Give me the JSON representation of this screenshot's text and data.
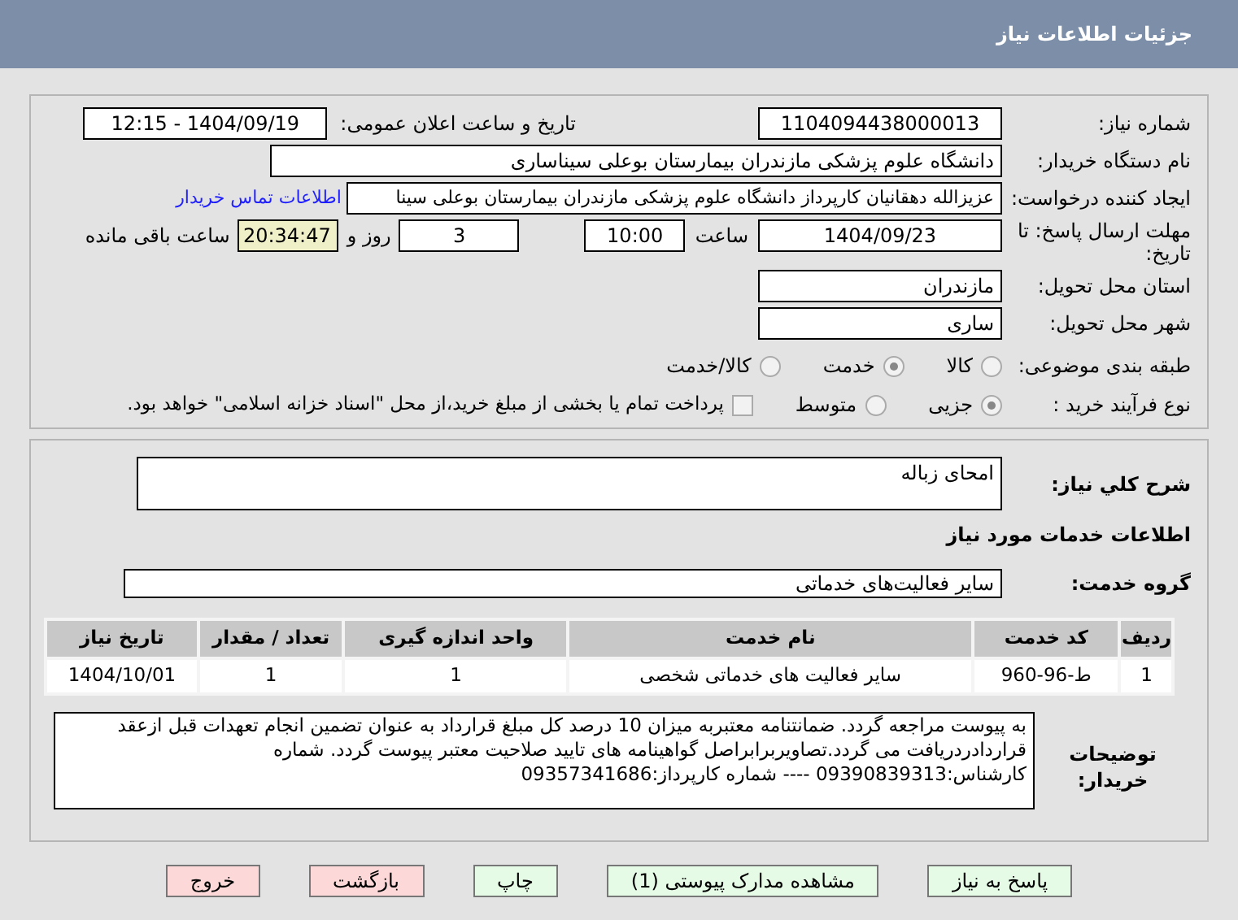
{
  "header": {
    "title": "جزئیات اطلاعات نیاز"
  },
  "need_number": {
    "label": "شماره نیاز:",
    "value": "1104094438000013"
  },
  "announce_date": {
    "label": "تاریخ و ساعت اعلان عمومی:",
    "value": "1404/09/19 - 12:15"
  },
  "buyer_org": {
    "label": "نام دستگاه خریدار:",
    "value": "دانشگاه علوم پزشکی مازندران بیمارستان بوعلی سیناساری"
  },
  "requester": {
    "label": "ایجاد کننده درخواست:",
    "value": "عزیزالله دهقانیان کارپرداز دانشگاه علوم پزشکی مازندران بیمارستان بوعلی سینا",
    "link": "اطلاعات تماس خریدار"
  },
  "deadline": {
    "label": "مهلت ارسال پاسخ: تا تاریخ:",
    "date": "1404/09/23",
    "time_label": "ساعت",
    "time": "10:00",
    "days": "3",
    "days_label": "روز و",
    "remaining": "20:34:47",
    "remaining_label": "ساعت باقی مانده"
  },
  "province": {
    "label": "استان محل تحویل:",
    "value": "مازندران"
  },
  "city": {
    "label": "شهر محل تحویل:",
    "value": "ساری"
  },
  "subject_category": {
    "label": "طبقه بندی موضوعی:",
    "options": [
      {
        "label": "کالا",
        "selected": false
      },
      {
        "label": "خدمت",
        "selected": true
      },
      {
        "label": "کالا/خدمت",
        "selected": false
      }
    ]
  },
  "purchase_process": {
    "label": "نوع فرآیند خرید :",
    "options": [
      {
        "label": "جزیی",
        "selected": true
      },
      {
        "label": "متوسط",
        "selected": false
      }
    ],
    "checkbox": {
      "label": "پرداخت تمام یا بخشی از مبلغ خرید،از محل \"اسناد خزانه اسلامی\" خواهد بود.",
      "checked": false
    }
  },
  "summary": {
    "label": "شرح کلي نياز:",
    "value": "امحای زباله"
  },
  "services_heading": "اطلاعات خدمات مورد نیاز",
  "service_group": {
    "label": "گروه خدمت:",
    "value": "سایر فعالیت‌های خدماتی"
  },
  "table": {
    "columns": [
      "ردیف",
      "کد خدمت",
      "نام خدمت",
      "واحد اندازه گیری",
      "تعداد / مقدار",
      "تاریخ نیاز"
    ],
    "rows": [
      [
        "1",
        "ط-96-960",
        "سایر فعالیت های خدماتی شخصی",
        "1",
        "1",
        "1404/10/01"
      ]
    ]
  },
  "buyer_notes": {
    "label": "توضیحات خریدار:",
    "value": "به پیوست مراجعه گردد. ضمانتنامه معتبربه میزان 10 درصد کل مبلغ قرارداد به عنوان تضمین انجام تعهدات قبل ازعقد قراردادردریافت می گردد.تصاویربرابراصل گواهینامه های تایید صلاحیت معتبر پیوست گردد. شماره کارشناس:09390839313 ---- شماره کارپرداز:09357341686"
  },
  "buttons": [
    {
      "label": "پاسخ به نیاز",
      "kind": "action"
    },
    {
      "label": "مشاهده مدارک پیوستی (1)",
      "kind": "action"
    },
    {
      "label": "چاپ",
      "kind": "action"
    },
    {
      "label": "بازگشت",
      "kind": "exit"
    },
    {
      "label": "خروج",
      "kind": "exit"
    }
  ]
}
